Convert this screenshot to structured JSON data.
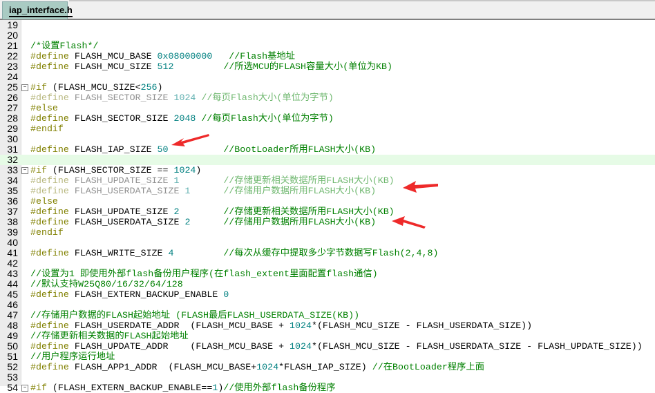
{
  "tab": {
    "label": "iap_interface.h"
  },
  "colors": {
    "preprocessor": "#808000",
    "number": "#008080",
    "comment": "#008000",
    "arrow": "#ee2a2a"
  },
  "lines": [
    {
      "n": "19",
      "seg": []
    },
    {
      "n": "20",
      "seg": []
    },
    {
      "n": "21",
      "seg": [
        [
          "cm",
          "/*设置Flash*/"
        ]
      ]
    },
    {
      "n": "22",
      "seg": [
        [
          "pp",
          "#define "
        ],
        [
          "id",
          "FLASH_MCU_BASE "
        ],
        [
          "num",
          "0x08000000"
        ],
        [
          "id",
          "   "
        ],
        [
          "cm",
          "//Flash基地址"
        ]
      ]
    },
    {
      "n": "23",
      "seg": [
        [
          "pp",
          "#define "
        ],
        [
          "id",
          "FLASH_MCU_SIZE "
        ],
        [
          "num",
          "512"
        ],
        [
          "id",
          "         "
        ],
        [
          "cm",
          "//所选MCU的FLASH容量大小(单位为KB)"
        ]
      ]
    },
    {
      "n": "24",
      "seg": []
    },
    {
      "n": "25",
      "fold": true,
      "seg": [
        [
          "pp",
          "#if "
        ],
        [
          "id",
          "(FLASH_MCU_SIZE<"
        ],
        [
          "num",
          "256"
        ],
        [
          "id",
          ")"
        ]
      ]
    },
    {
      "n": "26",
      "seg": [
        [
          "ipp",
          "#define "
        ],
        [
          "iid",
          "FLASH_SECTOR_SIZE "
        ],
        [
          "inum",
          "1024"
        ],
        [
          "id",
          " "
        ],
        [
          "icm",
          "//每页Flash大小(单位为字节)"
        ]
      ]
    },
    {
      "n": "27",
      "seg": [
        [
          "pp",
          "#else"
        ]
      ]
    },
    {
      "n": "28",
      "seg": [
        [
          "pp",
          "#define "
        ],
        [
          "id",
          "FLASH_SECTOR_SIZE "
        ],
        [
          "num",
          "2048"
        ],
        [
          "id",
          " "
        ],
        [
          "cm",
          "//每页Flash大小(单位为字节)"
        ]
      ]
    },
    {
      "n": "29",
      "seg": [
        [
          "pp",
          "#endif"
        ]
      ]
    },
    {
      "n": "30",
      "seg": []
    },
    {
      "n": "31",
      "seg": [
        [
          "pp",
          "#define "
        ],
        [
          "id",
          "FLASH_IAP_SIZE "
        ],
        [
          "num",
          "50"
        ],
        [
          "id",
          "          "
        ],
        [
          "cm",
          "//BootLoader所用FLASH大小(KB)"
        ]
      ]
    },
    {
      "n": "32",
      "hl": true,
      "seg": []
    },
    {
      "n": "33",
      "fold": true,
      "seg": [
        [
          "pp",
          "#if "
        ],
        [
          "id",
          "(FLASH_SECTOR_SIZE == "
        ],
        [
          "num",
          "1024"
        ],
        [
          "id",
          ")"
        ]
      ]
    },
    {
      "n": "34",
      "seg": [
        [
          "ipp",
          "#define "
        ],
        [
          "iid",
          "FLASH_UPDATE_SIZE "
        ],
        [
          "inum",
          "1"
        ],
        [
          "id",
          "        "
        ],
        [
          "icm",
          "//存储更新相关数据所用FLASH大小(KB)"
        ]
      ]
    },
    {
      "n": "35",
      "seg": [
        [
          "ipp",
          "#define "
        ],
        [
          "iid",
          "FLASH_USERDATA_SIZE "
        ],
        [
          "inum",
          "1"
        ],
        [
          "id",
          "      "
        ],
        [
          "icm",
          "//存储用户数据所用FLASH大小(KB)"
        ]
      ]
    },
    {
      "n": "36",
      "seg": [
        [
          "pp",
          "#else"
        ]
      ]
    },
    {
      "n": "37",
      "seg": [
        [
          "pp",
          "#define "
        ],
        [
          "id",
          "FLASH_UPDATE_SIZE "
        ],
        [
          "num",
          "2"
        ],
        [
          "id",
          "        "
        ],
        [
          "cm",
          "//存储更新相关数据所用FLASH大小(KB)"
        ]
      ]
    },
    {
      "n": "38",
      "seg": [
        [
          "pp",
          "#define "
        ],
        [
          "id",
          "FLASH_USERDATA_SIZE "
        ],
        [
          "num",
          "2"
        ],
        [
          "id",
          "      "
        ],
        [
          "cm",
          "//存储用户数据所用FLASH大小(KB)"
        ]
      ]
    },
    {
      "n": "39",
      "seg": [
        [
          "pp",
          "#endif"
        ]
      ]
    },
    {
      "n": "40",
      "seg": []
    },
    {
      "n": "41",
      "seg": [
        [
          "pp",
          "#define "
        ],
        [
          "id",
          "FLASH_WRITE_SIZE "
        ],
        [
          "num",
          "4"
        ],
        [
          "id",
          "         "
        ],
        [
          "cm",
          "//每次从缓存中提取多少字节数据写Flash(2,4,8)"
        ]
      ]
    },
    {
      "n": "42",
      "seg": []
    },
    {
      "n": "43",
      "seg": [
        [
          "cm",
          "//设置为1 即使用外部flash备份用户程序(在flash_extent里面配置flash通信)"
        ]
      ]
    },
    {
      "n": "44",
      "seg": [
        [
          "cm",
          "//默认支持W25Q80/16/32/64/128"
        ]
      ]
    },
    {
      "n": "45",
      "seg": [
        [
          "pp",
          "#define "
        ],
        [
          "id",
          "FLASH_EXTERN_BACKUP_ENABLE "
        ],
        [
          "num",
          "0"
        ]
      ]
    },
    {
      "n": "46",
      "seg": []
    },
    {
      "n": "47",
      "seg": [
        [
          "cm",
          "//存储用户数据的FLASH起始地址 (FLASH最后FLASH_USERDATA_SIZE(KB))"
        ]
      ]
    },
    {
      "n": "48",
      "seg": [
        [
          "pp",
          "#define "
        ],
        [
          "id",
          "FLASH_USERDATE_ADDR  (FLASH_MCU_BASE + "
        ],
        [
          "num",
          "1024"
        ],
        [
          "id",
          "*(FLASH_MCU_SIZE - FLASH_USERDATA_SIZE))"
        ]
      ]
    },
    {
      "n": "49",
      "seg": [
        [
          "cm",
          "//存储更新相关数据的FLASH起始地址"
        ]
      ]
    },
    {
      "n": "50",
      "seg": [
        [
          "pp",
          "#define "
        ],
        [
          "id",
          "FLASH_UPDATE_ADDR    (FLASH_MCU_BASE + "
        ],
        [
          "num",
          "1024"
        ],
        [
          "id",
          "*(FLASH_MCU_SIZE - FLASH_USERDATA_SIZE - FLASH_UPDATE_SIZE))"
        ]
      ]
    },
    {
      "n": "51",
      "seg": [
        [
          "cm",
          "//用户程序运行地址"
        ]
      ]
    },
    {
      "n": "52",
      "seg": [
        [
          "pp",
          "#define "
        ],
        [
          "id",
          "FLASH_APP1_ADDR  (FLASH_MCU_BASE+"
        ],
        [
          "num",
          "1024"
        ],
        [
          "id",
          "*FLASH_IAP_SIZE) "
        ],
        [
          "cm",
          "//在BootLoader程序上面"
        ]
      ]
    },
    {
      "n": "53",
      "seg": []
    },
    {
      "n": "54",
      "fold": true,
      "seg": [
        [
          "pp",
          "#if "
        ],
        [
          "id",
          "(FLASH_EXTERN_BACKUP_ENABLE=="
        ],
        [
          "num",
          "1"
        ],
        [
          "id",
          ")"
        ],
        [
          "cm",
          "//使用外部flash备份程序"
        ]
      ]
    }
  ]
}
